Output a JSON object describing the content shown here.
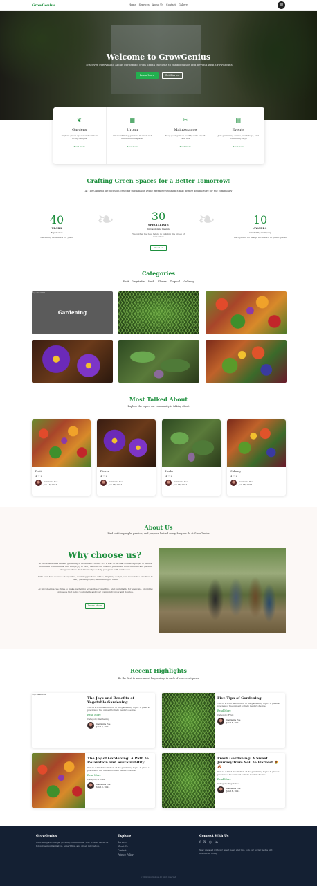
{
  "nav": {
    "logo": "GrowGenius",
    "links": [
      "Home",
      "Services",
      "About Us",
      "Contact",
      "Gallery"
    ]
  },
  "hero": {
    "title": "Welcome to GrowGenius",
    "subtitle": "Discover everything about gardening from urban gardens to maintenance and beyond with GrowGenius",
    "learn_more": "Learn More",
    "get_started": "Get Started"
  },
  "features": [
    {
      "icon": "leaf-icon",
      "glyph": "❦",
      "title": "Gardens",
      "desc": "Explore green spaces and outdoor living designs",
      "link": "Read more"
    },
    {
      "icon": "building-icon",
      "glyph": "▦",
      "title": "Urban",
      "desc": "Create thriving gardens in small and limited urban spaces",
      "link": "Read more"
    },
    {
      "icon": "tools-icon",
      "glyph": "✂",
      "title": "Maintenance",
      "desc": "Keep your garden healthy with expert care tips",
      "link": "Read more"
    },
    {
      "icon": "calendar-icon",
      "glyph": "▤",
      "title": "Events",
      "desc": "Join gardening events, workshops, and community days",
      "link": "Read more"
    }
  ],
  "crafting": {
    "title": "Crafting Green Spaces for a Better Tomorrow!",
    "subtitle": "At The Gardens we focus on creating sustainable living green environments that inspire and nurture for the community",
    "stats": [
      {
        "num": "40",
        "label": "YEARS",
        "s1": "Experience",
        "s2": "Delivering excellence for years"
      },
      {
        "num": "30",
        "label": "SPECIALISTS",
        "s1": "In Gardening Design",
        "s2": "We gather the best talent in building the green of tomorrow",
        "btn": "About Us"
      },
      {
        "num": "10",
        "label": "AWARDS",
        "s1": "Gardening Company",
        "s2": "Recognized for design excellence in green spaces"
      }
    ]
  },
  "categories": {
    "title": "Categories",
    "tabs": [
      "Fruit",
      "Vegetable",
      "Herb",
      "Flower",
      "Tropical",
      "Culinary"
    ],
    "featured_tag": "Top Tutorial",
    "featured_label": "Gardening"
  },
  "talked": {
    "title": "Most Talked About",
    "subtitle": "Explore the topics our community is talking about",
    "cards": [
      {
        "title": "Fruit",
        "meta": "4 ♡ 2",
        "author": "Gardenia Poe",
        "date": "Jan 18, 2024"
      },
      {
        "title": "Flower",
        "meta": "4 ♡ 2",
        "author": "Gardenia Poe",
        "date": "Jan 18, 2024"
      },
      {
        "title": "Herbs",
        "meta": "4 ♡ 2",
        "author": "Gardenia Poe",
        "date": "Jan 18, 2024"
      },
      {
        "title": "Culinary",
        "meta": "4 ♡ 2",
        "author": "Gardenia Poe",
        "date": "Jan 18, 2024"
      }
    ]
  },
  "about": {
    "title": "About Us",
    "subtitle": "Find out the people, passion, and purpose behind everything we do at GrowGenius",
    "why": "Why choose us?",
    "p1": "At GrowGenius we believe gardening is more than a hobby: it's a way of life that connects people to nature, nourishes communities, and brings joy to every season. Our team of passionate horticulturists and garden designers share their knowledge to help you grow with confidence.",
    "p2": "With over four decades of expertise, we bring practical advice, inspiring design, and sustainable practices to every garden project, whether big or small.",
    "p3": "At GrowGenius, we strive to make gardening accessible, rewarding, and sustainable for everyone, providing guidance that helps your plants and your community grow and flourish.",
    "learn_more": "Learn More"
  },
  "highlights": {
    "title": "Recent Highlights",
    "subtitle": "Be the first to know about happenings in each of our recent posts",
    "top_tag": "Top Featured",
    "items": [
      {
        "title": "The Joys and Benefits of Vegetable Gardening",
        "desc": "This is a brief description of the gardening topic. It gives a preview of the content to help readers decide.",
        "read": "Read More",
        "cat": "Category: Gardening",
        "author": "Gardenia Poe",
        "date": "Jan 18, 2024"
      },
      {
        "title": "Five Tips of Gardening",
        "desc": "This is a brief description of the gardening topic. It gives a preview of the content to help readers decide.",
        "read": "Read More",
        "cat": "Category: Fruit",
        "author": "Gardenia Poe",
        "date": "Jan 18, 2024"
      },
      {
        "title": "The Joy of Gardening: A Path to Relaxation and Sustainability",
        "desc": "This is a brief description of the gardening topic. It gives a preview of the content to help readers decide.",
        "read": "Read More",
        "cat": "Category: Flower",
        "author": "Gardenia Poe",
        "date": "Jan 18, 2024"
      },
      {
        "title": "Fresh Gardening: A Sweet Journey from Soil to Harvest 🌻 🍂",
        "desc": "This is a brief description of the gardening topic. It gives a preview of the content to help readers decide.",
        "read": "Read More",
        "cat": "Category: Vegetable",
        "author": "Gardenia Poe",
        "date": "Jan 18, 2024"
      }
    ]
  },
  "footer": {
    "brand": "GrowGenius",
    "brand_desc": "Cultivating knowledge, growing communities. Your trusted resource for gardening inspiration, expert tips, and green innovation.",
    "explore_title": "Explore",
    "explore_links": [
      "Services",
      "About Us",
      "Contact",
      "Privacy Policy"
    ],
    "connect_title": "Connect With Us",
    "connect_desc": "Stay updated with our latest news and tips, join our social media and newsletter today.",
    "social": [
      "f",
      "𝕏",
      "◎",
      "in"
    ],
    "copyright": "© 2024 GrowGenius. All rights reserved."
  }
}
